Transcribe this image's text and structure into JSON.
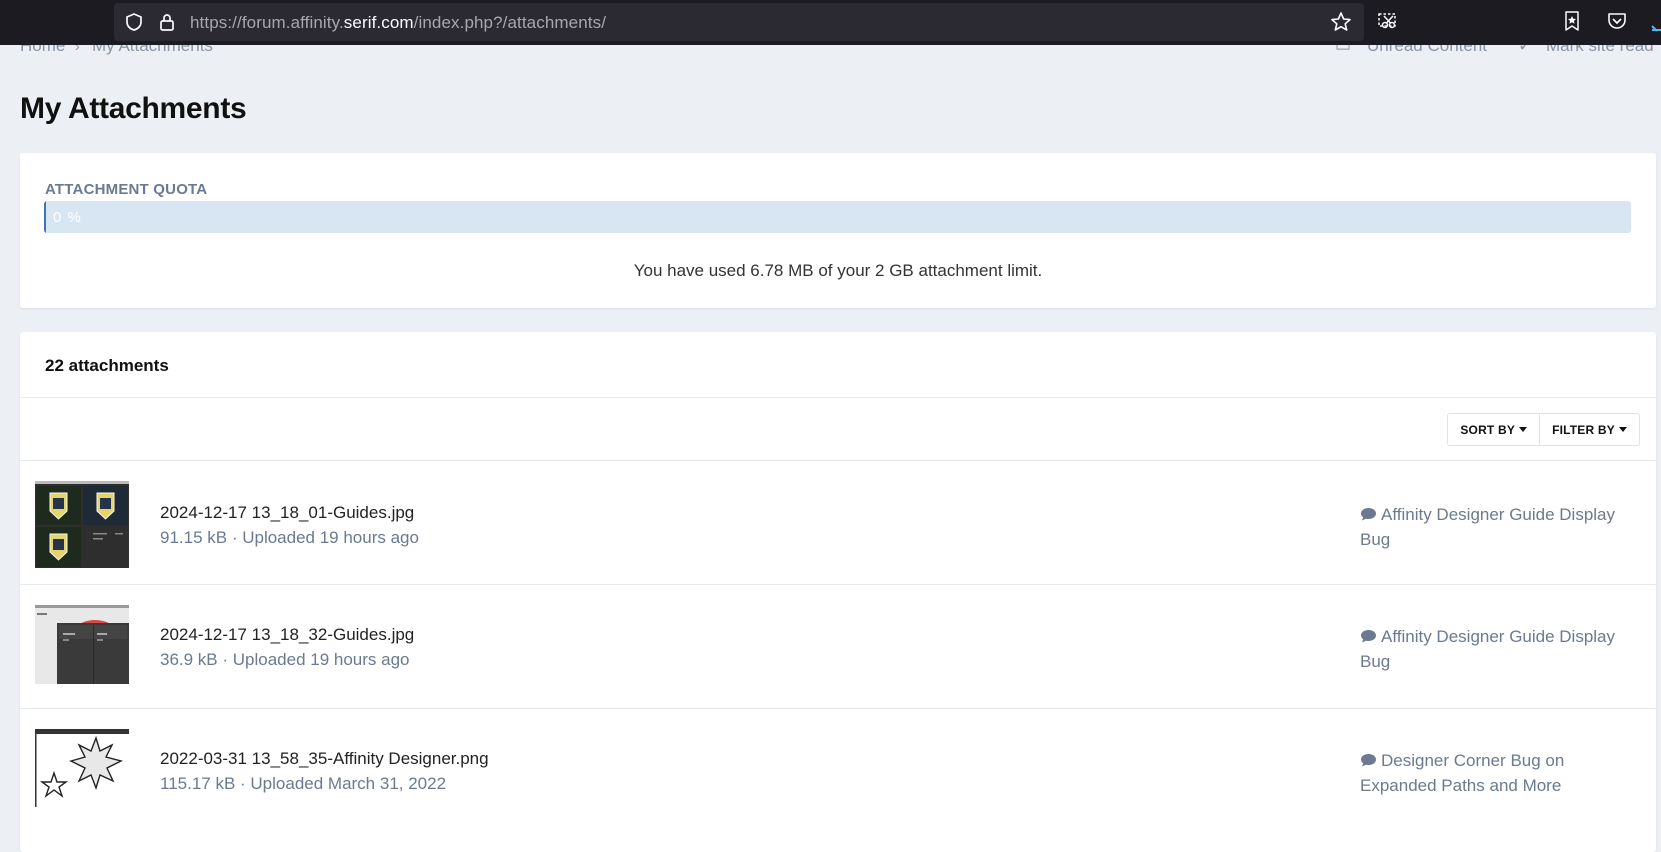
{
  "browser": {
    "url_prefix": "https://forum.affinity.",
    "url_host": "serif.com",
    "url_path": "/index.php?/attachments/"
  },
  "nav_peek": {
    "breadcrumb_home": "Home",
    "breadcrumb_current": "My Attachments",
    "unread_content": "Unread Content",
    "mark_site_read": "Mark site read"
  },
  "page": {
    "title": "My Attachments"
  },
  "quota": {
    "label": "ATTACHMENT QUOTA",
    "percent_text": "0  %",
    "percent_value": 0,
    "message": "You have used 6.78 MB of your 2 GB attachment limit."
  },
  "attachments": {
    "count_label": "22 attachments",
    "sort_label": "SORT BY",
    "filter_label": "FILTER BY",
    "items": [
      {
        "name": "2024-12-17 13_18_01-Guides.jpg",
        "meta": "91.15 kB · Uploaded 19 hours ago",
        "topic": "Affinity Designer Guide Display Bug"
      },
      {
        "name": "2024-12-17 13_18_32-Guides.jpg",
        "meta": "36.9 kB · Uploaded 19 hours ago",
        "topic": "Affinity Designer Guide Display Bug"
      },
      {
        "name": "2022-03-31 13_58_35-Affinity Designer.png",
        "meta": "115.17 kB · Uploaded March 31, 2022",
        "topic": "Designer Corner Bug on Expanded Paths and More"
      }
    ]
  },
  "colors": {
    "accent": "#3e76b3",
    "muted_text": "#6b7a90",
    "page_bg": "#eceff4",
    "chrome_bg": "#1c1b22"
  }
}
